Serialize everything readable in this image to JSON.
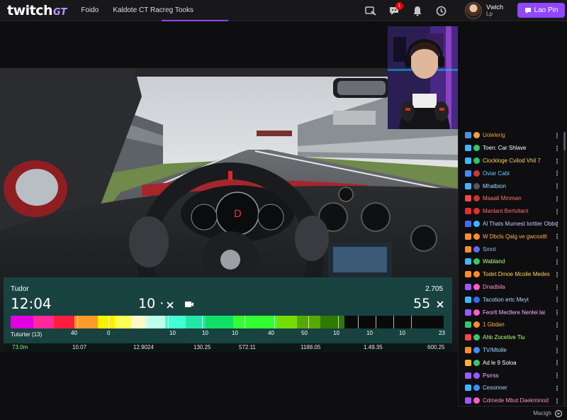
{
  "nav": {
    "logo_main": "twitch",
    "logo_suffix": "GT",
    "links": [
      "Foido",
      "Kaldote CT Racreg Tooks"
    ],
    "notifications_count": "1",
    "user_name": "Vwich",
    "user_sub": "Lp",
    "primary_label": "Lao Pin"
  },
  "hud": {
    "left_label": "Tudor",
    "time": "12:04",
    "center_value": "10 ·",
    "right_top": "2.705",
    "right_value": "55",
    "scale_label": "Tuturter (13)",
    "scale_ticks": [
      "40",
      "0",
      "10",
      "10",
      "10",
      "40",
      "50",
      "10",
      "10",
      "10",
      "23"
    ],
    "footer_values": [
      "73.0m",
      "10.07",
      "12.9024",
      "130.25",
      "572.11",
      "1188.05",
      "1.49.35",
      "600.25"
    ],
    "colors": [
      "#e000e0",
      "#ff2a9a",
      "#ff1f3c",
      "#ff9a2a",
      "#fff000",
      "#ffff55",
      "#fff9c8",
      "#bfffe8",
      "#44ffd4",
      "#22e6a8",
      "#12e066",
      "#33ff33",
      "#77dd00",
      "#55aa00",
      "#2f7a00",
      "#0a0a0a"
    ]
  },
  "chat": {
    "messages": [
      {
        "text": "Uolelerig",
        "color": "#f2a03a",
        "badge": "#4a90e2",
        "dot": "#f2a03a"
      },
      {
        "text": "Toen: Car Shlave",
        "color": "#ffffff",
        "badge": "#3fb6ff",
        "dot": "#35c86b"
      },
      {
        "text": "Ciockloge Cvilod Vhil 7",
        "color": "#ffd35c",
        "badge": "#3fb6ff",
        "dot": "#2bc26d"
      },
      {
        "text": "Oviar Cabi",
        "color": "#5cd4ff",
        "badge": "#3f8cff",
        "dot": "#c43a3a"
      },
      {
        "text": "Mhatbion",
        "color": "#9fdcff",
        "badge": "#3fb6ff",
        "dot": "#555560"
      },
      {
        "text": "Maaali Mmman",
        "color": "#ff7373",
        "badge": "#ff4545",
        "dot": "#c13535"
      },
      {
        "text": "Manlant Bertvitant",
        "color": "#ff6b6b",
        "badge": "#e02f2f",
        "dot": "#e02f2f"
      },
      {
        "text": "Al Thats Mumest lorttier Obbo",
        "color": "#c8c8ff",
        "badge": "#3f6bff",
        "dot": "#3fb6ff"
      },
      {
        "text": "W Dbcls Qalg ve gwcosttl",
        "color": "#ffb347",
        "badge": "#ff8c2a",
        "dot": "#ff8c2a"
      },
      {
        "text": "Smnt",
        "color": "#9fb2ff",
        "badge": "#ff8c2a",
        "dot": "#5f6bff"
      },
      {
        "text": "Wabland",
        "color": "#b3ff7a",
        "badge": "#3fb6ff",
        "dot": "#35c86b"
      },
      {
        "text": "Todet Dmoe Mcolie Medes",
        "color": "#ffd35c",
        "badge": "#ff8c2a",
        "dot": "#ff8c2a"
      },
      {
        "text": "Dnadbila",
        "color": "#ff8cc8",
        "badge": "#9b59ff",
        "dot": "#ff5ec4"
      },
      {
        "text": "Tacotion ertc Meyt",
        "color": "#9fdcff",
        "badge": "#3fb6ff",
        "dot": "#2f6bff"
      },
      {
        "text": "Feorlt Mecllere Nenlei lai",
        "color": "#ffb3ff",
        "badge": "#9b59ff",
        "dot": "#ff5ec4"
      },
      {
        "text": "1 Gbdan",
        "color": "#ffb347",
        "badge": "#35c86b",
        "dot": "#ff8c2a"
      },
      {
        "text": "Ahb Zocetive Tiu",
        "color": "#b3ff7a",
        "badge": "#ff4545",
        "dot": "#35c86b"
      },
      {
        "text": "TV/Mtolle",
        "color": "#9fdcff",
        "badge": "#ff8c2a",
        "dot": "#3f8cff"
      },
      {
        "text": "Ad le 9 Soloa",
        "color": "#ffffff",
        "badge": "#ffb12a",
        "dot": "#35c86b"
      },
      {
        "text": "Psrrss",
        "color": "#ffb3ff",
        "badge": "#9b59ff",
        "dot": "#9b59ff"
      },
      {
        "text": "Cesonner",
        "color": "#9fdcff",
        "badge": "#3fb6ff",
        "dot": "#3f8cff"
      },
      {
        "text": "Cdmede Mbut Daekminod",
        "color": "#ff8cc8",
        "badge": "#9b59ff",
        "dot": "#ff5ec4"
      }
    ],
    "footer_label": "Macigh"
  },
  "colors": {
    "accent": "#9147ff",
    "bg": "#0e0e10",
    "panel": "#18181b"
  }
}
